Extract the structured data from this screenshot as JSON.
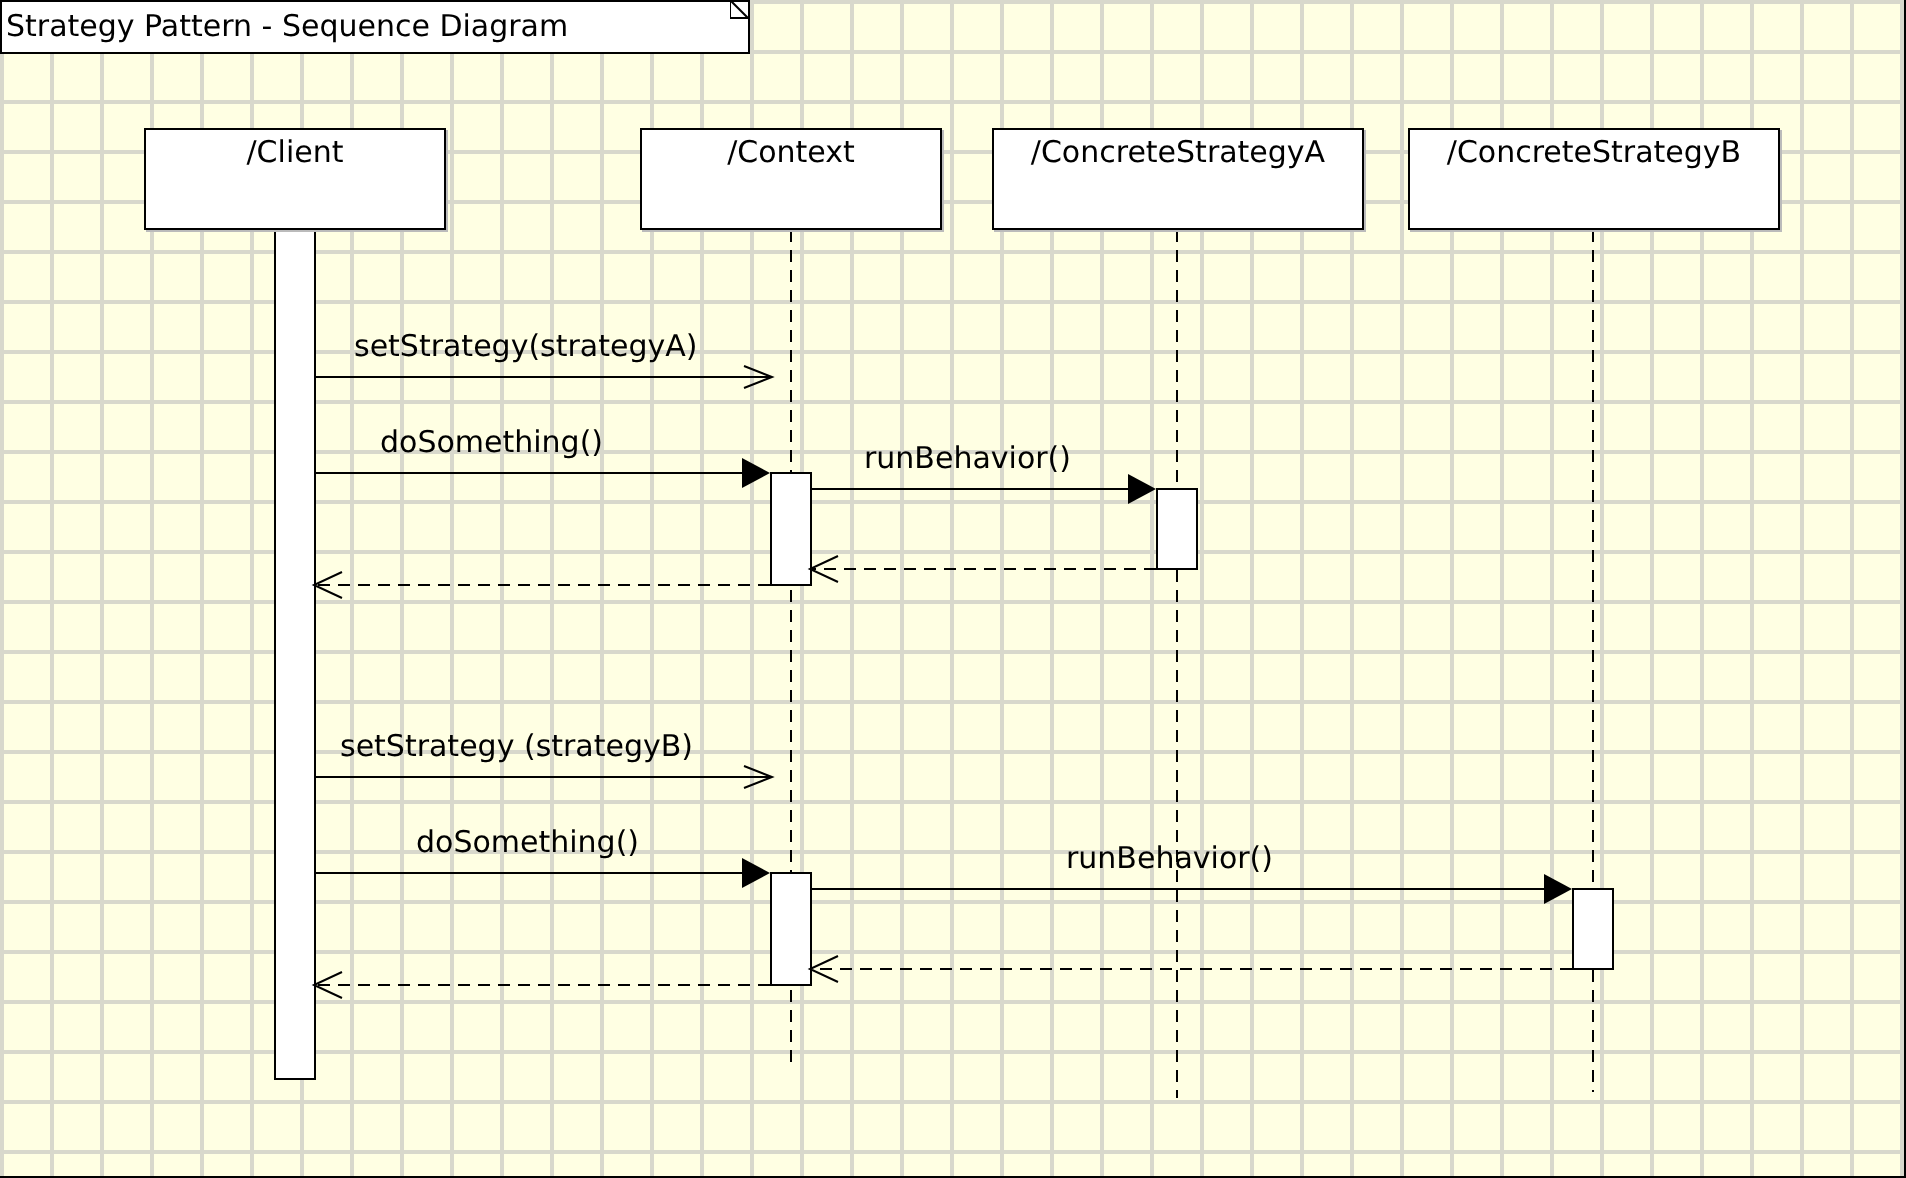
{
  "title": "Strategy Pattern - Sequence Diagram",
  "lifelines": [
    {
      "name": "/Client"
    },
    {
      "name": "/Context"
    },
    {
      "name": "/ConcreteStrategyA"
    },
    {
      "name": "/ConcreteStrategyB"
    }
  ],
  "messages": [
    {
      "kind": "async",
      "label": "setStrategy(strategyA)"
    },
    {
      "kind": "sync",
      "label": "doSomething()"
    },
    {
      "kind": "sync",
      "label": "runBehavior()"
    },
    {
      "kind": "reply"
    },
    {
      "kind": "reply"
    },
    {
      "kind": "async",
      "label": "setStrategy (strategyB)"
    },
    {
      "kind": "sync",
      "label": "doSomething()"
    },
    {
      "kind": "sync",
      "label": "runBehavior()"
    },
    {
      "kind": "reply"
    },
    {
      "kind": "reply"
    }
  ]
}
